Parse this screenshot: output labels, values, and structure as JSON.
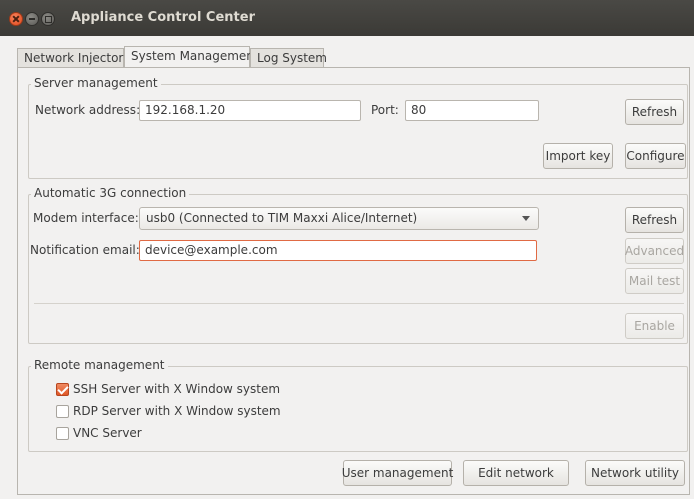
{
  "window": {
    "title": "Appliance Control Center"
  },
  "tabs": [
    {
      "label": "Network Injector"
    },
    {
      "label": "System Management"
    },
    {
      "label": "Log System"
    }
  ],
  "server": {
    "legend": "Server management",
    "address_label": "Network address:",
    "address_value": "192.168.1.20",
    "port_label": "Port:",
    "port_value": "80",
    "refresh": "Refresh",
    "import_key": "Import key",
    "configure": "Configure"
  },
  "g3": {
    "legend": "Automatic 3G connection",
    "modem_label": "Modem interface:",
    "modem_value": "usb0 (Connected to TIM Maxxi Alice/Internet)",
    "email_label": "Notification email:",
    "email_value": "device@example.com",
    "refresh": "Refresh",
    "advanced": "Advanced",
    "mail_test": "Mail test",
    "enable": "Enable"
  },
  "remote": {
    "legend": "Remote management",
    "options": [
      {
        "label": "SSH Server with X Window system",
        "checked": true
      },
      {
        "label": "RDP Server with X Window system",
        "checked": false
      },
      {
        "label": "VNC Server",
        "checked": false
      }
    ]
  },
  "footer": {
    "user_management": "User management",
    "edit_network": "Edit network",
    "network_utility": "Network utility"
  }
}
